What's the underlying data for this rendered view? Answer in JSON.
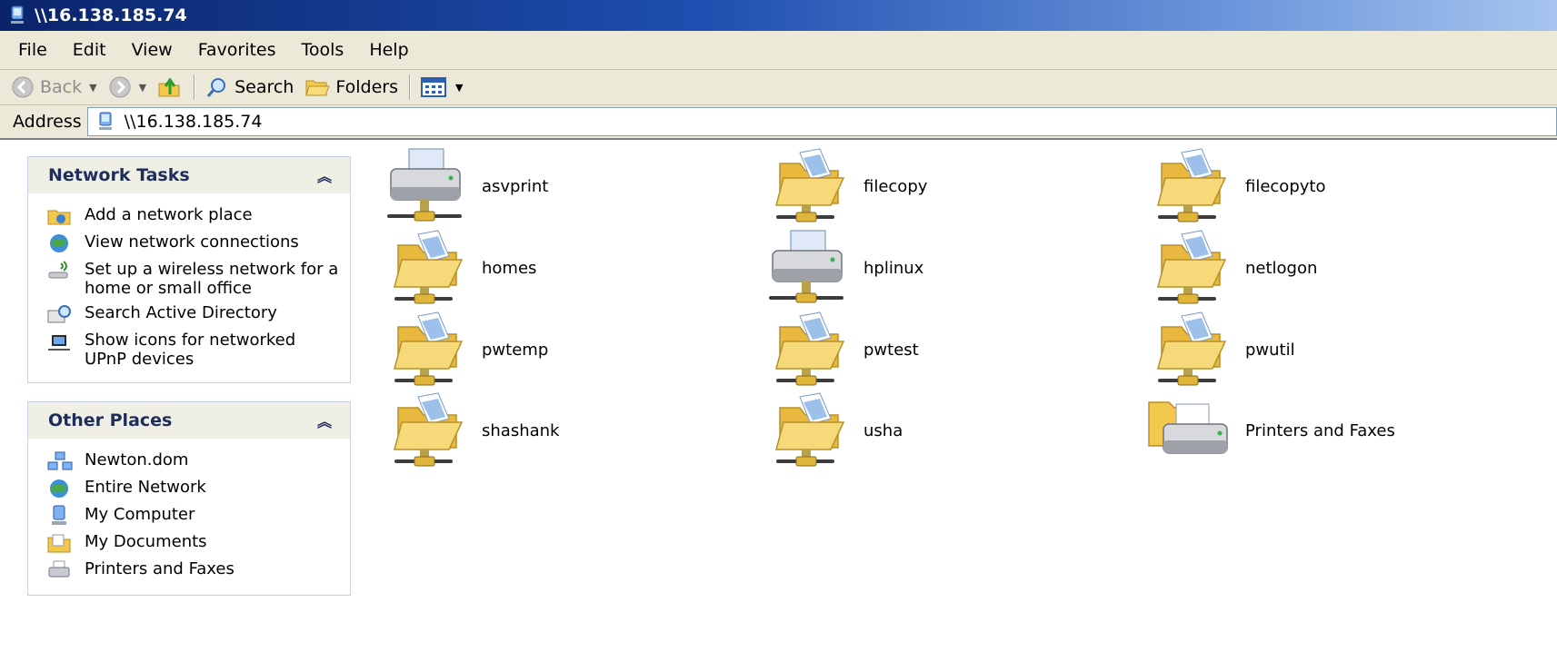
{
  "window": {
    "title": "\\\\16.138.185.74"
  },
  "menu": [
    "File",
    "Edit",
    "View",
    "Favorites",
    "Tools",
    "Help"
  ],
  "toolbar": {
    "back": "Back",
    "search": "Search",
    "folders": "Folders"
  },
  "address": {
    "label": "Address",
    "value": "\\\\16.138.185.74"
  },
  "sidebar": {
    "network_tasks": {
      "title": "Network Tasks",
      "items": [
        {
          "label": "Add a network place",
          "icon": "add-network-place-icon"
        },
        {
          "label": "View network connections",
          "icon": "network-connections-icon"
        },
        {
          "label": "Set up a wireless network for a home or small office",
          "icon": "wireless-network-icon"
        },
        {
          "label": "Search Active Directory",
          "icon": "search-directory-icon"
        },
        {
          "label": "Show icons for networked UPnP devices",
          "icon": "upnp-devices-icon"
        }
      ]
    },
    "other_places": {
      "title": "Other Places",
      "items": [
        {
          "label": "Newton.dom",
          "icon": "domain-icon"
        },
        {
          "label": "Entire Network",
          "icon": "entire-network-icon"
        },
        {
          "label": "My Computer",
          "icon": "my-computer-icon"
        },
        {
          "label": "My Documents",
          "icon": "my-documents-icon"
        },
        {
          "label": "Printers and Faxes",
          "icon": "printers-faxes-icon"
        }
      ]
    }
  },
  "shares": [
    {
      "name": "asvprint",
      "type": "printer"
    },
    {
      "name": "filecopy",
      "type": "folder"
    },
    {
      "name": "filecopyto",
      "type": "folder"
    },
    {
      "name": "homes",
      "type": "folder"
    },
    {
      "name": "hplinux",
      "type": "printer"
    },
    {
      "name": "netlogon",
      "type": "folder"
    },
    {
      "name": "pwtemp",
      "type": "folder"
    },
    {
      "name": "pwtest",
      "type": "folder"
    },
    {
      "name": "pwutil",
      "type": "folder"
    },
    {
      "name": "shashank",
      "type": "folder"
    },
    {
      "name": "usha",
      "type": "folder"
    },
    {
      "name": "Printers and Faxes",
      "type": "printers-folder"
    }
  ],
  "colors": {
    "title_start": "#0a246a",
    "title_end": "#a6c4ee",
    "chrome": "#ece9d8",
    "panel_head_text": "#1e2d5c",
    "folder": "#f2d36a"
  }
}
